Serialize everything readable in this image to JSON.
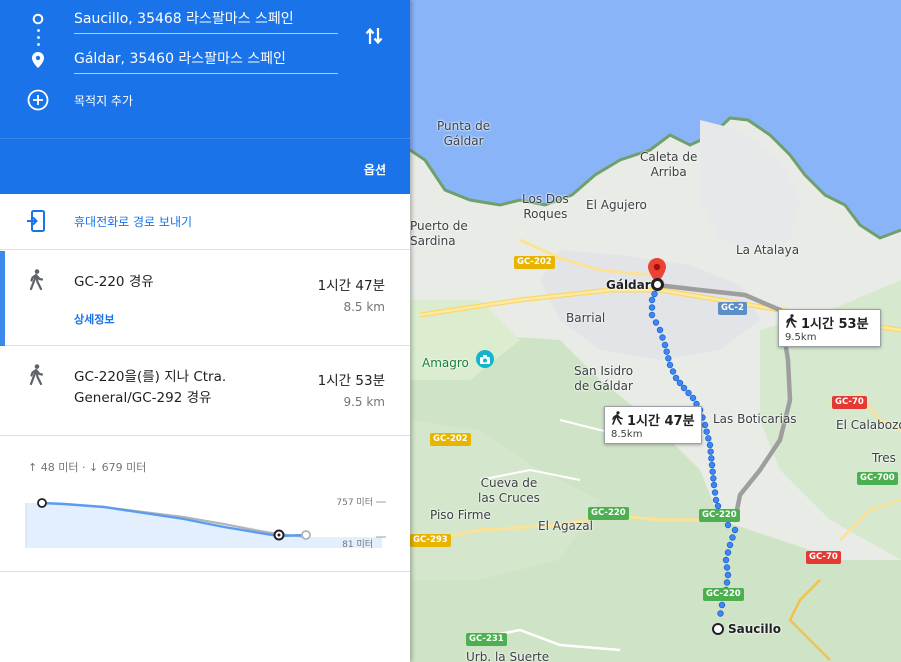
{
  "directions": {
    "origin": "Saucillo, 35468 라스팔마스 스페인",
    "destination": "Gáldar, 35460 라스팔마스 스페인",
    "add_destination": "목적지 추가",
    "options": "옵션",
    "send_to_phone": "휴대전화로 경로 보내기"
  },
  "routes": [
    {
      "via": "GC-220 경유",
      "duration": "1시간 47분",
      "distance": "8.5 km",
      "details": "상세정보"
    },
    {
      "via_line1": "GC-220을(를) 지나 Ctra.",
      "via_line2": "General/GC-292 경유",
      "duration": "1시간 53분",
      "distance": "9.5 km"
    }
  ],
  "elevation": {
    "ascent": "48 미터",
    "descent": "679 미터",
    "max_label": "757 미터",
    "min_label": "81 미터"
  },
  "map": {
    "places": {
      "punta_line1": "Punta de",
      "punta_line2": "Gáldar",
      "caleta_line1": "Caleta de",
      "caleta_line2": "Arriba",
      "los_dos_line1": "Los Dos",
      "los_dos_line2": "Roques",
      "agujero": "El Agujero",
      "puerto_line1": "Puerto de",
      "puerto_line2": "Sardina",
      "atalaya": "La Atalaya",
      "galdar": "Gáldar",
      "barrial": "Barrial",
      "amagro": "Amagro",
      "san_isidro_line1": "San Isidro",
      "san_isidro_line2": "de Gáldar",
      "boticarias": "Las Boticarias",
      "calabozo": "El Calabozo",
      "tres": "Tres",
      "cueva_line1": "Cueva de",
      "cueva_line2": "las Cruces",
      "piso_firme": "Piso Firme",
      "agazal": "El Agazal",
      "saucillo": "Saucillo",
      "urb": "Urb. la Suerte"
    },
    "roads": {
      "gc202_a": "GC-202",
      "gc2": "GC-2",
      "gc202_b": "GC-202",
      "gc70_a": "GC-70",
      "gc700": "GC-700",
      "gc220_a": "GC-220",
      "gc220_b": "GC-220",
      "gc220_c": "GC-220",
      "gc293": "GC-293",
      "gc70_b": "GC-70",
      "gc231": "GC-231"
    },
    "callouts": {
      "primary_time": "1시간 47분",
      "primary_dist": "8.5km",
      "alt_time": "1시간 53분",
      "alt_dist": "9.5km"
    }
  },
  "colors": {
    "panel_blue": "#1a73e8",
    "route_primary": "#4285f4",
    "route_alt": "#9e9e9e",
    "sea": "#8ab4f8",
    "marker_red": "#ea4335"
  },
  "icons": {
    "origin": "circle-outline-icon",
    "destination": "location-pin-icon",
    "swap": "swap-vertical-icon",
    "add": "add-circle-icon",
    "send": "send-to-phone-icon",
    "walk": "walking-person-icon"
  }
}
